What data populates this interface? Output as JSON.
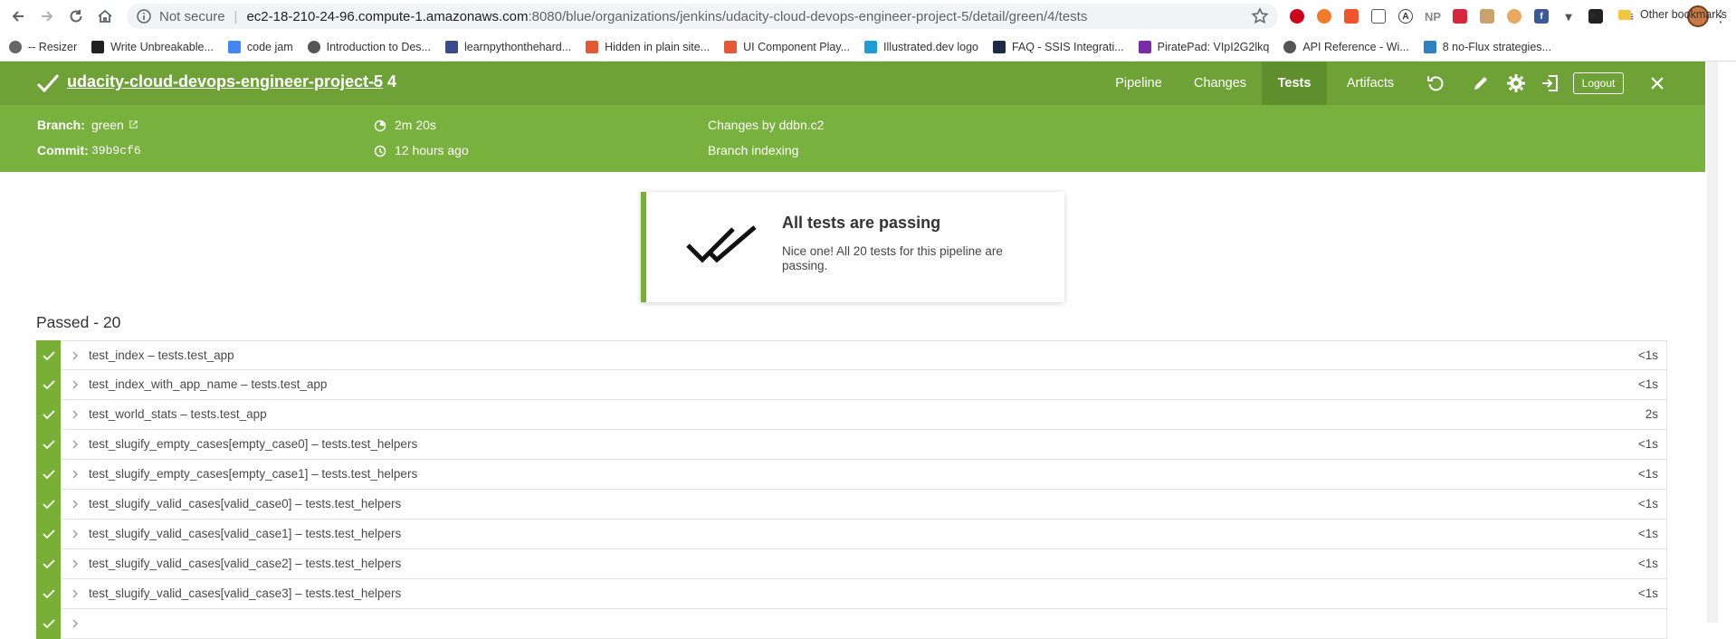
{
  "browser": {
    "security_label": "Not secure",
    "url_host": "ec2-18-210-24-96.compute-1.amazonaws.com",
    "url_path": ":8080/blue/organizations/jenkins/udacity-cloud-devops-engineer-project-5/detail/green/4/tests",
    "extension_labels": [
      "NP"
    ],
    "bookmarks": [
      {
        "label": "-- Resizer",
        "icon": "globe-icon",
        "color": "#666666"
      },
      {
        "label": "Write Unbreakable...",
        "icon": "lambda-icon",
        "color": "#222222"
      },
      {
        "label": "code jam",
        "icon": "google-icon",
        "color": "#4285f4"
      },
      {
        "label": "Introduction to Des...",
        "icon": "globe-icon",
        "color": "#555555"
      },
      {
        "label": "learnpythonthehard...",
        "icon": "book-icon",
        "color": "#3a4b8c"
      },
      {
        "label": "Hidden in plain site...",
        "icon": "codepen-icon",
        "color": "#e45a36"
      },
      {
        "label": "UI Component Play...",
        "icon": "codepen-icon",
        "color": "#e45a36"
      },
      {
        "label": "Illustrated.dev logo",
        "icon": "chevron-logo-icon",
        "color": "#1b9dd6"
      },
      {
        "label": "FAQ - SSIS Integrati...",
        "icon": "k-icon",
        "color": "#1d2a4a"
      },
      {
        "label": "PiratePad: VIpI2G2lkq",
        "icon": "pp-icon",
        "color": "#7a2ca8"
      },
      {
        "label": "API Reference - Wi...",
        "icon": "globe-icon",
        "color": "#555555"
      },
      {
        "label": "8 no-Flux strategies...",
        "icon": "cubes-icon",
        "color": "#2f7fc1"
      }
    ],
    "more_label": "»",
    "other_bookmarks": "Other bookmarks"
  },
  "header": {
    "job_name": "udacity-cloud-devops-engineer-project-5",
    "run_number": "4",
    "tabs": [
      "Pipeline",
      "Changes",
      "Tests",
      "Artifacts"
    ],
    "active_tab": "Tests",
    "logout_label": "Logout"
  },
  "run_info": {
    "branch_label": "Branch:",
    "branch_value": "green",
    "commit_label": "Commit:",
    "commit_value": "39b9cf6",
    "duration": "2m 20s",
    "time_ago": "12 hours ago",
    "changes": "Changes by ddbn.c2",
    "cause": "Branch indexing"
  },
  "summary_card": {
    "title": "All tests are passing",
    "message": "Nice one! All 20 tests for this pipeline are passing."
  },
  "passed_heading": "Passed - 20",
  "tests": [
    {
      "name": "test_index – tests.test_app",
      "duration": "<1s"
    },
    {
      "name": "test_index_with_app_name – tests.test_app",
      "duration": "<1s"
    },
    {
      "name": "test_world_stats – tests.test_app",
      "duration": "2s"
    },
    {
      "name": "test_slugify_empty_cases[empty_case0] – tests.test_helpers",
      "duration": "<1s"
    },
    {
      "name": "test_slugify_empty_cases[empty_case1] – tests.test_helpers",
      "duration": "<1s"
    },
    {
      "name": "test_slugify_valid_cases[valid_case0] – tests.test_helpers",
      "duration": "<1s"
    },
    {
      "name": "test_slugify_valid_cases[valid_case1] – tests.test_helpers",
      "duration": "<1s"
    },
    {
      "name": "test_slugify_valid_cases[valid_case2] – tests.test_helpers",
      "duration": "<1s"
    },
    {
      "name": "test_slugify_valid_cases[valid_case3] – tests.test_helpers",
      "duration": "<1s"
    },
    {
      "name": "",
      "duration": ""
    }
  ],
  "colors": {
    "header_green": "#6ea237",
    "subheader_green": "#79b13e",
    "success_green": "#78b037"
  }
}
